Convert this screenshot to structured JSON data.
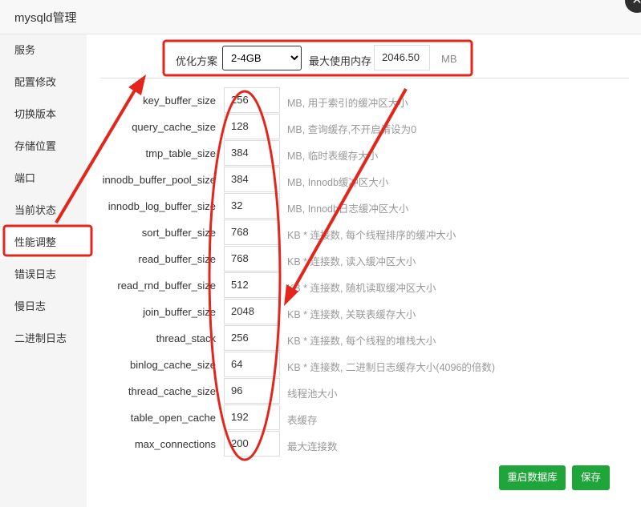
{
  "window": {
    "title": "mysqld管理"
  },
  "sidebar": {
    "items": [
      {
        "label": "服务"
      },
      {
        "label": "配置修改"
      },
      {
        "label": "切换版本"
      },
      {
        "label": "存储位置"
      },
      {
        "label": "端口"
      },
      {
        "label": "当前状态"
      },
      {
        "label": "性能调整",
        "active": true
      },
      {
        "label": "错误日志"
      },
      {
        "label": "慢日志"
      },
      {
        "label": "二进制日志"
      }
    ]
  },
  "optimize": {
    "plan_label": "优化方案",
    "plan_value": "2-4GB",
    "max_mem_label": "最大使用内存",
    "max_mem_value": "2046.50",
    "max_mem_unit": "MB"
  },
  "settings": [
    {
      "name": "key_buffer_size",
      "value": "256",
      "desc": "MB, 用于索引的缓冲区大小"
    },
    {
      "name": "query_cache_size",
      "value": "128",
      "desc": "MB, 查询缓存,不开启请设为0"
    },
    {
      "name": "tmp_table_size",
      "value": "384",
      "desc": "MB, 临时表缓存大小"
    },
    {
      "name": "innodb_buffer_pool_size",
      "value": "384",
      "desc": "MB, Innodb缓冲区大小"
    },
    {
      "name": "innodb_log_buffer_size",
      "value": "32",
      "desc": "MB, Innodb日志缓冲区大小"
    },
    {
      "name": "sort_buffer_size",
      "value": "768",
      "desc": "KB * 连接数, 每个线程排序的缓冲大小"
    },
    {
      "name": "read_buffer_size",
      "value": "768",
      "desc": "KB * 连接数, 读入缓冲区大小"
    },
    {
      "name": "read_rnd_buffer_size",
      "value": "512",
      "desc": "KB * 连接数, 随机读取缓冲区大小"
    },
    {
      "name": "join_buffer_size",
      "value": "2048",
      "desc": "KB * 连接数, 关联表缓存大小"
    },
    {
      "name": "thread_stack",
      "value": "256",
      "desc": "KB * 连接数, 每个线程的堆栈大小"
    },
    {
      "name": "binlog_cache_size",
      "value": "64",
      "desc": "KB * 连接数, 二进制日志缓存大小(4096的倍数)"
    },
    {
      "name": "thread_cache_size",
      "value": "96",
      "desc": "线程池大小"
    },
    {
      "name": "table_open_cache",
      "value": "192",
      "desc": "表缓存"
    },
    {
      "name": "max_connections",
      "value": "200",
      "desc": "最大连接数"
    }
  ],
  "buttons": {
    "restart": "重启数据库",
    "save": "保存"
  },
  "colors": {
    "accent": "#20a53a",
    "annotation": "#e3261b"
  }
}
